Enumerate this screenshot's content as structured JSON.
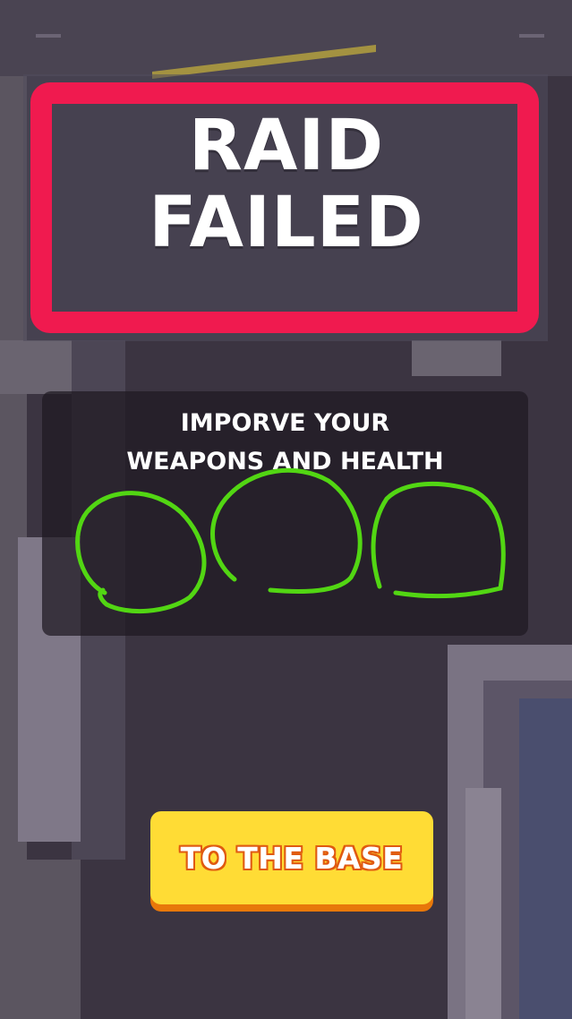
{
  "title": {
    "line1": "RAID",
    "line2": "FAILED"
  },
  "info": {
    "line1": "IMPORVE YOUR",
    "line2": "WEAPONS AND HEALTH"
  },
  "button": {
    "label": "TO THE BASE"
  },
  "colors": {
    "frame": "#f01a4f",
    "button": "#ffdc35",
    "button_shadow": "#e8780a",
    "scribble": "#52d613"
  }
}
